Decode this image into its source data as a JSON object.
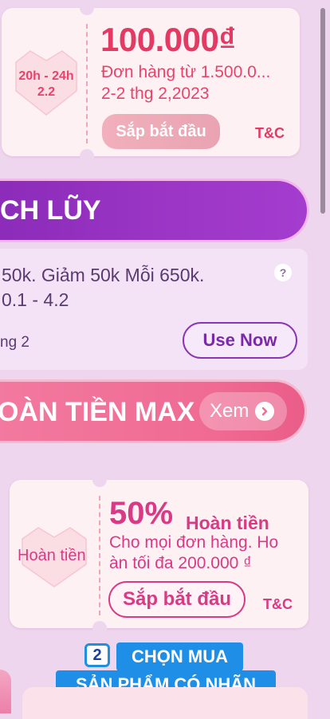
{
  "voucher1": {
    "time_range": "20h - 24h",
    "time_date": "2.2",
    "amount": "100.000₫",
    "condition": "Đơn hàng từ 1.500.0...",
    "validity": "2-2 thg 2,2023",
    "status_button": "Sắp bắt đầu",
    "terms": "T&C"
  },
  "banner_accumulate": {
    "title": "CH LŨY"
  },
  "voucher2": {
    "description": "50k. Giảm 50k Mỗi 650k.",
    "dates": "0.1 - 4.2",
    "footer": "ng 2",
    "help": "?",
    "button": "Use Now"
  },
  "banner_cashback": {
    "title": "OÀN TIỀN MAX",
    "view_button": "Xem"
  },
  "voucher3": {
    "side_label": "Hoàn tiền",
    "percent": "50%",
    "percent_label": "Hoàn tiền",
    "line1": "Cho mọi đơn hàng. Ho",
    "line2": "àn tối đa 200.000 ₫",
    "status_button": "Sắp bắt đầu",
    "terms": "T&C"
  },
  "step_badge": {
    "number": "2",
    "line1": "CHỌN MUA",
    "line2": "SẢN PHẨM CÓ NHÃN"
  },
  "colors": {
    "background": "#efd6ef",
    "accent_red": "#e33a63",
    "accent_purple": "#8a2bb8",
    "accent_pink": "#d83a86",
    "badge_blue": "#1e8ee6"
  }
}
